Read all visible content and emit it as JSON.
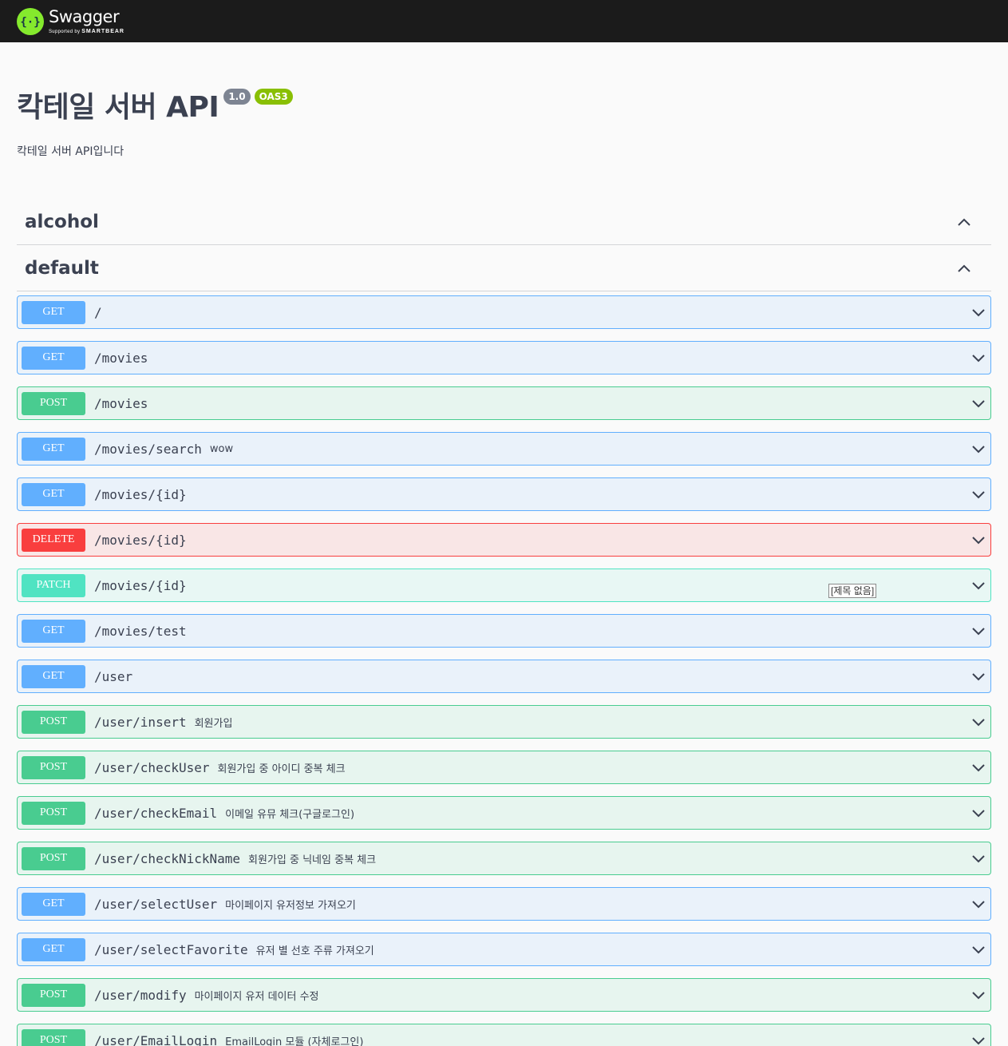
{
  "topbar": {
    "logo_title": "Swagger",
    "logo_sub_prefix": "Supported by",
    "logo_sub_brand": "SMARTBEAR",
    "logo_icon": "swagger-braces-icon",
    "colors": {
      "background": "#1b1b1b",
      "logo_green": "#85ea2d"
    }
  },
  "info": {
    "title": "칵테일 서버 API",
    "version": "1.0",
    "oas_badge": "OAS3",
    "description": "칵테일 서버 API입니다"
  },
  "tags": [
    {
      "name": "alcohol",
      "icon": "chevron-up-icon"
    },
    {
      "name": "default",
      "icon": "chevron-up-icon"
    }
  ],
  "operations": [
    {
      "method": "GET",
      "path": "/",
      "summary": "",
      "style": "get"
    },
    {
      "method": "GET",
      "path": "/movies",
      "summary": "",
      "style": "get"
    },
    {
      "method": "POST",
      "path": "/movies",
      "summary": "",
      "style": "post"
    },
    {
      "method": "GET",
      "path": "/movies/search",
      "summary": "wow",
      "style": "get"
    },
    {
      "method": "GET",
      "path": "/movies/{id}",
      "summary": "",
      "style": "get"
    },
    {
      "method": "DELETE",
      "path": "/movies/{id}",
      "summary": "",
      "style": "delete"
    },
    {
      "method": "PATCH",
      "path": "/movies/{id}",
      "summary": "",
      "style": "patch",
      "tooltip": "[제목 없음]"
    },
    {
      "method": "GET",
      "path": "/movies/test",
      "summary": "",
      "style": "get"
    },
    {
      "method": "GET",
      "path": "/user",
      "summary": "",
      "style": "get"
    },
    {
      "method": "POST",
      "path": "/user/insert",
      "summary": "회원가입",
      "style": "post"
    },
    {
      "method": "POST",
      "path": "/user/checkUser",
      "summary": "회원가입 중 아이디 중복 체크",
      "style": "post"
    },
    {
      "method": "POST",
      "path": "/user/checkEmail",
      "summary": "이메일 유뮤 체크(구글로그인)",
      "style": "post"
    },
    {
      "method": "POST",
      "path": "/user/checkNickName",
      "summary": "회원가입 중 닉네임 중복 체크",
      "style": "post"
    },
    {
      "method": "GET",
      "path": "/user/selectUser",
      "summary": "마이페이지 유저정보 가져오기",
      "style": "get"
    },
    {
      "method": "GET",
      "path": "/user/selectFavorite",
      "summary": "유저 별 선호 주류 가져오기",
      "style": "get"
    },
    {
      "method": "POST",
      "path": "/user/modify",
      "summary": "마이페이지 유저 데이터 수정",
      "style": "post"
    },
    {
      "method": "POST",
      "path": "/user/EmailLogin",
      "summary": "EmailLogin 모듈 (자체로그인)",
      "style": "post"
    }
  ],
  "colors": {
    "get": "#61affe",
    "post": "#49cc90",
    "delete": "#f93e3e",
    "patch": "#50e3c2",
    "version_badge": "#7d8492",
    "oas_badge": "#89bf04"
  }
}
